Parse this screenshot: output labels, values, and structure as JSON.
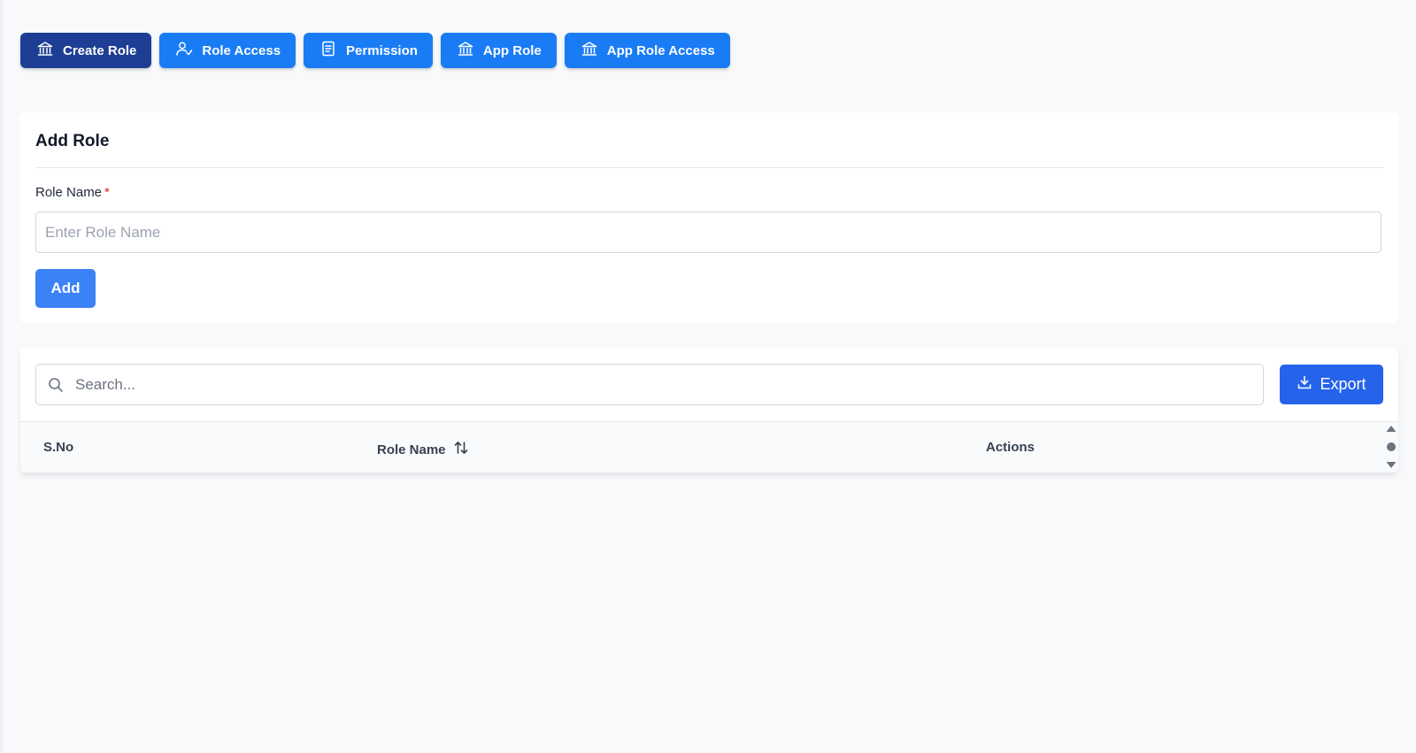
{
  "tabs": [
    {
      "label": "Create Role",
      "icon": "bank-icon",
      "active": true
    },
    {
      "label": "Role Access",
      "icon": "user-check-icon",
      "active": false
    },
    {
      "label": "Permission",
      "icon": "document-icon",
      "active": false
    },
    {
      "label": "App Role",
      "icon": "bank-icon",
      "active": false
    },
    {
      "label": "App Role Access",
      "icon": "bank-icon",
      "active": false
    }
  ],
  "add_role": {
    "title": "Add Role",
    "field_label": "Role Name",
    "required_mark": "*",
    "placeholder": "Enter Role Name",
    "value": "",
    "add_label": "Add"
  },
  "table": {
    "search_placeholder": "Search...",
    "export_label": "Export",
    "columns": [
      "S.No",
      "Role Name",
      "Actions"
    ],
    "rows": []
  },
  "colors": {
    "tab": "#1a7cf5",
    "tab_active": "#1d3e94",
    "add_button": "#3b82f6",
    "export_button": "#2563eb",
    "required": "#dc2626",
    "background": "#f8f9fb"
  }
}
